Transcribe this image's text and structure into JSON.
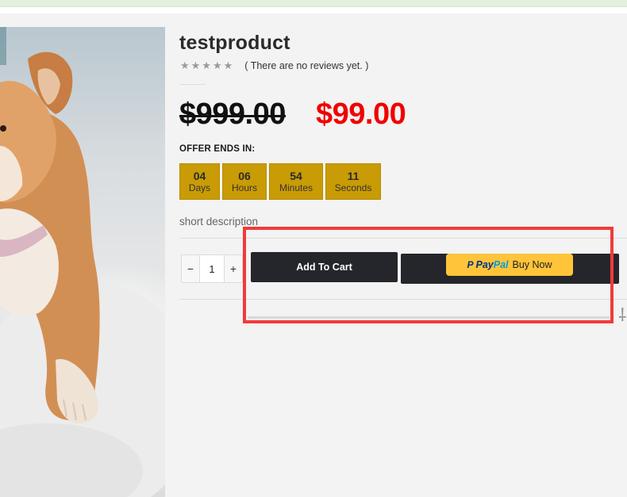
{
  "product": {
    "title": "testproduct",
    "rating_stars": "★★★★★",
    "rating_value": 0,
    "reviews_text": "( There are no reviews yet. )",
    "price_old": "$999.00",
    "price_new": "$99.00",
    "offer_label": "OFFER ENDS IN:",
    "countdown": [
      {
        "value": "04",
        "unit": "Days"
      },
      {
        "value": "06",
        "unit": "Hours"
      },
      {
        "value": "54",
        "unit": "Minutes"
      },
      {
        "value": "11",
        "unit": "Seconds"
      }
    ],
    "short_description": "short description"
  },
  "cart": {
    "minus": "−",
    "plus": "+",
    "quantity": "1",
    "add_to_cart": "Add To Cart",
    "paypal_mark": "P",
    "paypal_pay": "Pay",
    "paypal_pal": "Pal",
    "paypal_buy_now": "Buy Now"
  },
  "colors": {
    "accent_gold": "#c99b05",
    "sale_red": "#f00000",
    "button_dark": "#25262b",
    "paypal_yellow": "#ffc439",
    "highlight_red": "#f23a3a"
  }
}
